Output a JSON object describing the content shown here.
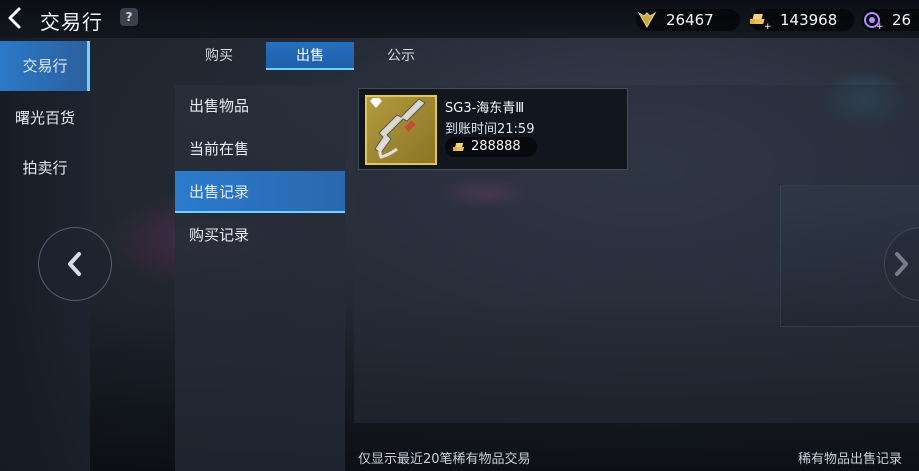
{
  "header": {
    "title": "交易行",
    "help": "?"
  },
  "currencies": [
    {
      "icon": "gem-currency-icon",
      "value": "26467"
    },
    {
      "icon": "gold-bars-add-icon",
      "value": "143968"
    },
    {
      "icon": "purple-coin-add-icon",
      "value": "26"
    }
  ],
  "leftnav": {
    "items": [
      {
        "label": "交易行",
        "active": true
      },
      {
        "label": "曙光百货"
      },
      {
        "label": "拍卖行"
      }
    ]
  },
  "tabs": [
    {
      "label": "购买"
    },
    {
      "label": "出售",
      "active": true
    },
    {
      "label": "公示"
    }
  ],
  "subnav": {
    "items": [
      {
        "label": "出售物品"
      },
      {
        "label": "当前在售"
      },
      {
        "label": "出售记录",
        "active": true
      },
      {
        "label": "购买记录"
      }
    ]
  },
  "records": [
    {
      "name": "SG3-海东青Ⅲ",
      "time": "到账时间21:59",
      "price": "288888",
      "icon": "shotgun-weapon-icon"
    }
  ],
  "footer": {
    "left": "仅显示最近20笔稀有物品交易",
    "right": "稀有物品出售记录"
  },
  "colors": {
    "accent": "#2b7bcd",
    "highlight": "#6fd2ff",
    "gold_frame": "#e3c65a"
  }
}
